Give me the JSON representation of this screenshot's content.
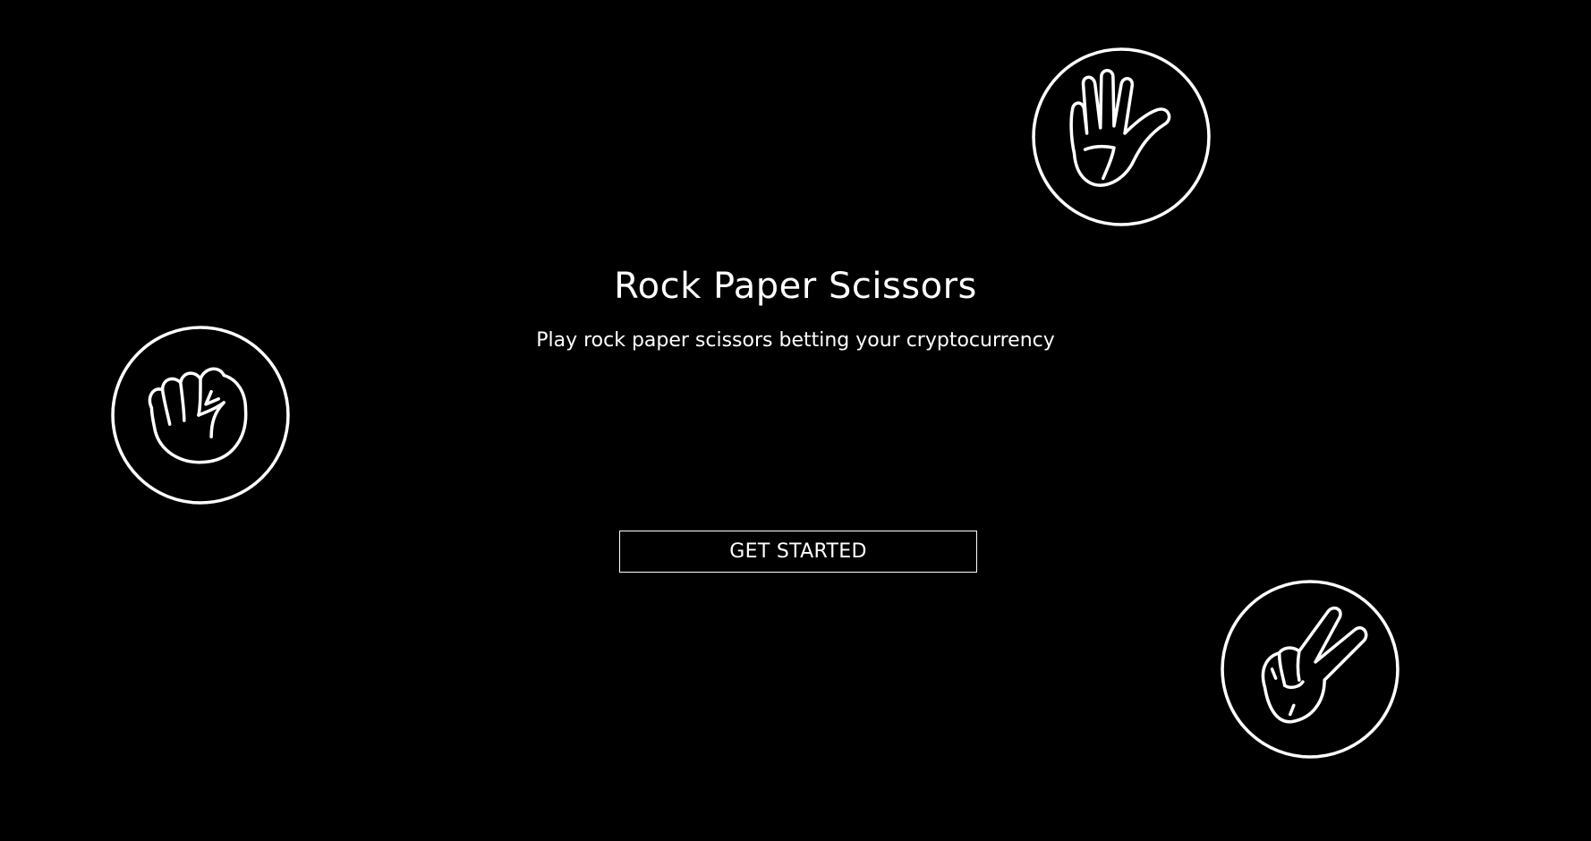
{
  "hero": {
    "title": "Rock Paper Scissors",
    "subtitle": "Play rock paper scissors betting your cryptocurrency",
    "cta_label": "GET STARTED"
  },
  "icons": {
    "rock": "fist-icon",
    "paper": "open-hand-icon",
    "scissors": "peace-hand-icon"
  },
  "colors": {
    "background": "#000000",
    "foreground": "#ffffff"
  }
}
